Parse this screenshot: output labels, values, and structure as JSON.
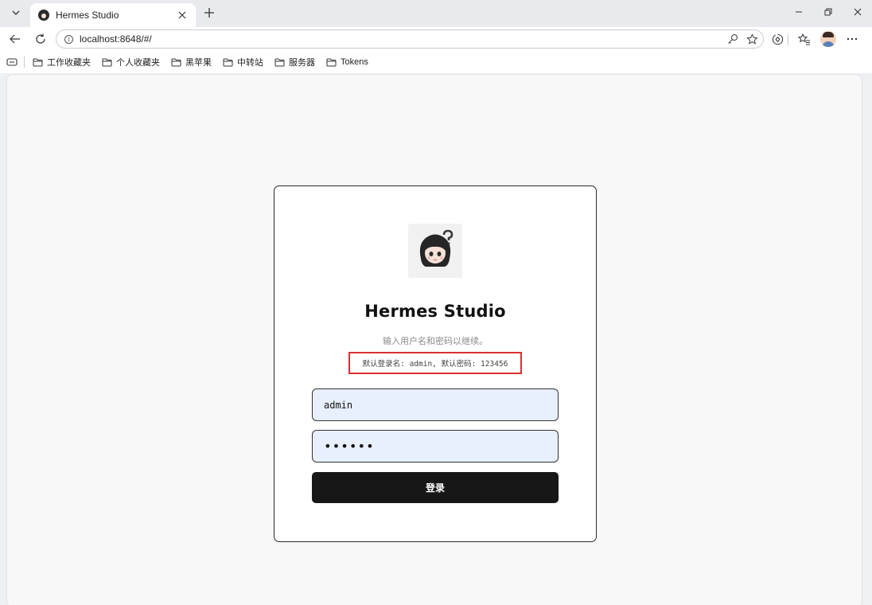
{
  "browser": {
    "tab": {
      "title": "Hermes Studio"
    },
    "address": {
      "url": "localhost:8648/#/"
    },
    "bookmarks": [
      {
        "label": "工作收藏夹"
      },
      {
        "label": "个人收藏夹"
      },
      {
        "label": "黑苹果"
      },
      {
        "label": "中转站"
      },
      {
        "label": "服务器"
      },
      {
        "label": "Tokens"
      }
    ]
  },
  "login": {
    "title": "Hermes Studio",
    "subtitle": "输入用户名和密码以继续。",
    "hint": "默认登录名: admin, 默认密码: 123456",
    "username_value": "admin",
    "password_value": "••••••",
    "submit_label": "登录"
  },
  "colors": {
    "button_bg": "#171717",
    "input_bg": "#e8f0fe",
    "hint_border": "#d9302f"
  },
  "icons": {
    "tab_menu": "chevron-down-icon",
    "tab_close": "close-icon",
    "new_tab": "plus-icon",
    "back": "arrow-left-icon",
    "reload": "reload-icon",
    "site_info": "info-icon",
    "read_aloud": "key-icon",
    "favorite": "star-icon",
    "extensions": "extension-icon",
    "favorites_list": "favorites-icon",
    "more": "ellipsis-icon",
    "bookmark_folder": "folder-icon"
  }
}
